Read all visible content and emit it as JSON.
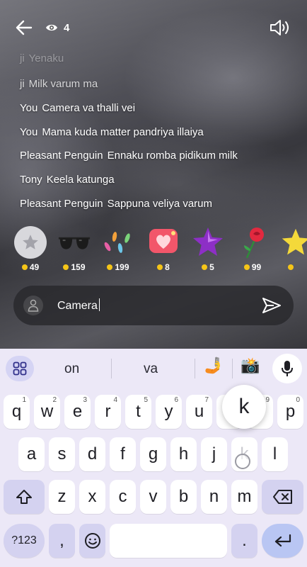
{
  "header": {
    "viewer_count": "4",
    "back_icon": "arrow-left-icon",
    "viewer_icon": "eye-icon",
    "sound_icon": "speaker-icon"
  },
  "chat": {
    "messages": [
      {
        "user": "ji",
        "text": "Yenaku"
      },
      {
        "user": "ji",
        "text": "Milk varum ma"
      },
      {
        "user": "You",
        "text": "Camera va thalli vei"
      },
      {
        "user": "You",
        "text": "Mama kuda matter pandriya illaiya"
      },
      {
        "user": "Pleasant Penguin",
        "text": "Ennaku romba pidikum milk"
      },
      {
        "user": "Tony",
        "text": "Keela katunga"
      },
      {
        "user": "Pleasant Penguin",
        "text": "Sappuna veliya varum"
      }
    ]
  },
  "gifts": [
    {
      "name": "star-gift-icon",
      "price": "49"
    },
    {
      "name": "sunglasses-gift-icon",
      "price": "159"
    },
    {
      "name": "footprints-gift-icon",
      "price": "199"
    },
    {
      "name": "heart-gift-icon",
      "price": "8"
    },
    {
      "name": "purple-star-gift-icon",
      "price": "5"
    },
    {
      "name": "rose-gift-icon",
      "price": "99"
    },
    {
      "name": "yellow-star-gift-icon",
      "price": ""
    }
  ],
  "input": {
    "value": "Camera",
    "avatar_icon": "user-icon",
    "send_icon": "send-icon"
  },
  "keyboard": {
    "suggestions": [
      "on",
      "va"
    ],
    "suggestion_emoji": [
      "🤳",
      "📸"
    ],
    "row1": [
      {
        "key": "q",
        "hint": "1"
      },
      {
        "key": "w",
        "hint": "2"
      },
      {
        "key": "e",
        "hint": "3"
      },
      {
        "key": "r",
        "hint": "4"
      },
      {
        "key": "t",
        "hint": "5"
      },
      {
        "key": "y",
        "hint": "6"
      },
      {
        "key": "u",
        "hint": "7"
      },
      {
        "key": "i",
        "hint": "8"
      },
      {
        "key": "o",
        "hint": "9"
      },
      {
        "key": "p",
        "hint": "0"
      }
    ],
    "row2": [
      "a",
      "s",
      "d",
      "f",
      "g",
      "h",
      "j",
      "k",
      "l"
    ],
    "row3": [
      "z",
      "x",
      "c",
      "v",
      "b",
      "n",
      "m"
    ],
    "popup_key": "k",
    "symbols_label": "?123",
    "comma_label": ",",
    "period_label": ".",
    "emoji_icon": "smiley-icon",
    "colors": {
      "keyboard_bg": "#ece8f7",
      "func_key": "#d4d2f0",
      "coin": "#f5c518"
    }
  }
}
